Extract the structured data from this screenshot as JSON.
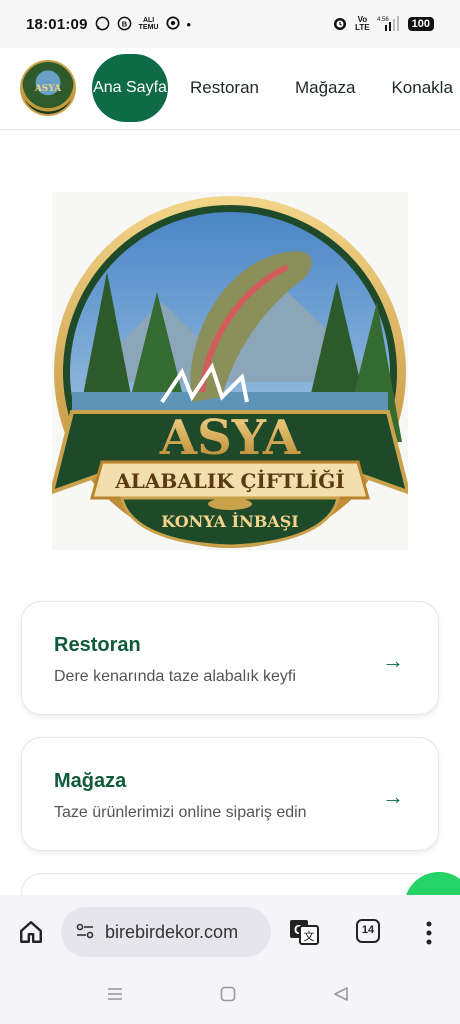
{
  "status_bar": {
    "time": "18:01:09",
    "left_icons": [
      "whatsapp-icon",
      "whatsapp-business-icon",
      "alibaba-temu-icon",
      "chrome-icon",
      "dot-icon"
    ],
    "tiny_label": "ALI\nTEMU",
    "right_icons": [
      "alarm-icon",
      "volte-icon",
      "signal-icon",
      "battery-icon"
    ],
    "volte": "Vo\nLTE",
    "net_speed": "4.56",
    "battery": "100"
  },
  "header": {
    "logo_text": "ASYA",
    "nav": [
      {
        "label": "Ana Sayfa",
        "active": true
      },
      {
        "label": "Restoran",
        "active": false
      },
      {
        "label": "Mağaza",
        "active": false
      },
      {
        "label": "Konakla",
        "active": false
      }
    ]
  },
  "hero": {
    "title": "ASYA",
    "subtitle": "ALABALIK ÇİFTLİĞİ",
    "location": "KONYA İNBAŞI"
  },
  "cards": [
    {
      "title": "Restoran",
      "desc": "Dere kenarında taze alabalık keyfi",
      "arrow": "→"
    },
    {
      "title": "Mağaza",
      "desc": "Taze ürünlerimizi online sipariş edin",
      "arrow": "→"
    }
  ],
  "browser": {
    "url": "birebirdekor.com",
    "tab_count": "14"
  },
  "colors": {
    "accent": "#0f6b45",
    "card_title": "#0f5a3a",
    "whatsapp": "#25d366"
  }
}
